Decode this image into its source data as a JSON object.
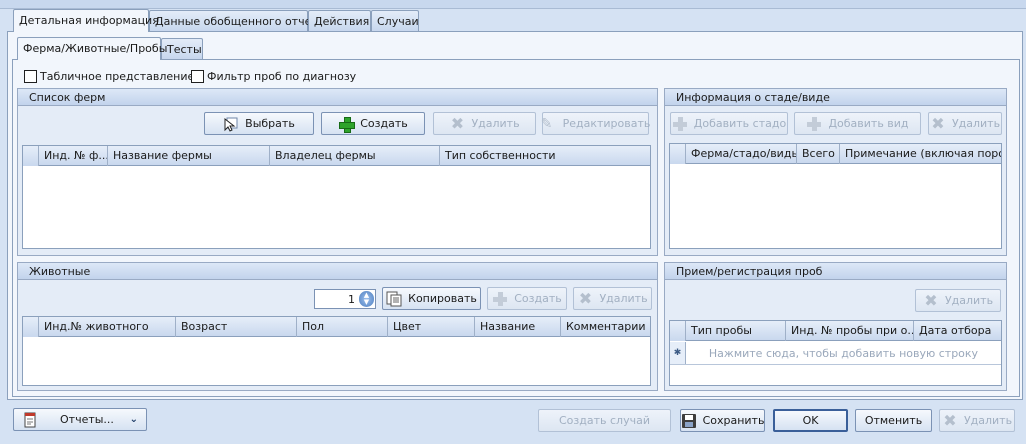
{
  "tabs_top": [
    "Детальная информация",
    "Данные обобщенного отчета",
    "Действия",
    "Случаи"
  ],
  "tabs_inner": [
    "Ферма/Животные/Пробы",
    "Тесты"
  ],
  "options": {
    "table_view": "Табличное представление",
    "filter_by_diagnosis": "Фильтр проб по диагнозу"
  },
  "farms": {
    "title": "Список ферм",
    "select": "Выбрать",
    "create": "Создать",
    "delete": "Удалить",
    "edit": "Редактировать",
    "columns": [
      "Инд. № ф...",
      "Название фермы",
      "Владелец фермы",
      "Тип собственности"
    ]
  },
  "herd": {
    "title": "Информация о стаде/виде",
    "add_herd": "Добавить стадо",
    "add_species": "Добавить вид",
    "delete": "Удалить",
    "columns": [
      "Ферма/стадо/виды",
      "Всего",
      "Примечание (включая поро..."
    ]
  },
  "animals": {
    "title": "Животные",
    "count": "1",
    "copy": "Копировать",
    "create": "Создать",
    "delete": "Удалить",
    "columns": [
      "Инд.№ животного",
      "Возраст",
      "Пол",
      "Цвет",
      "Название",
      "Комментарии"
    ]
  },
  "samples": {
    "title": "Прием/регистрация проб",
    "delete": "Удалить",
    "columns": [
      "Тип пробы",
      "Инд. № пробы при о...",
      "Дата отбора"
    ],
    "new_row_hint": "Нажмите сюда, чтобы добавить новую строку",
    "new_row_marker": "✱"
  },
  "footer": {
    "reports": "Отчеты...",
    "create_case": "Создать случай",
    "save": "Сохранить",
    "ok": "OK",
    "cancel": "Отменить",
    "delete": "Удалить"
  },
  "colors": {
    "background": "#d5e2f3",
    "panel": "#f2f6fc",
    "border": "#8ba0bc",
    "disabled_text": "#a2b0c2"
  }
}
